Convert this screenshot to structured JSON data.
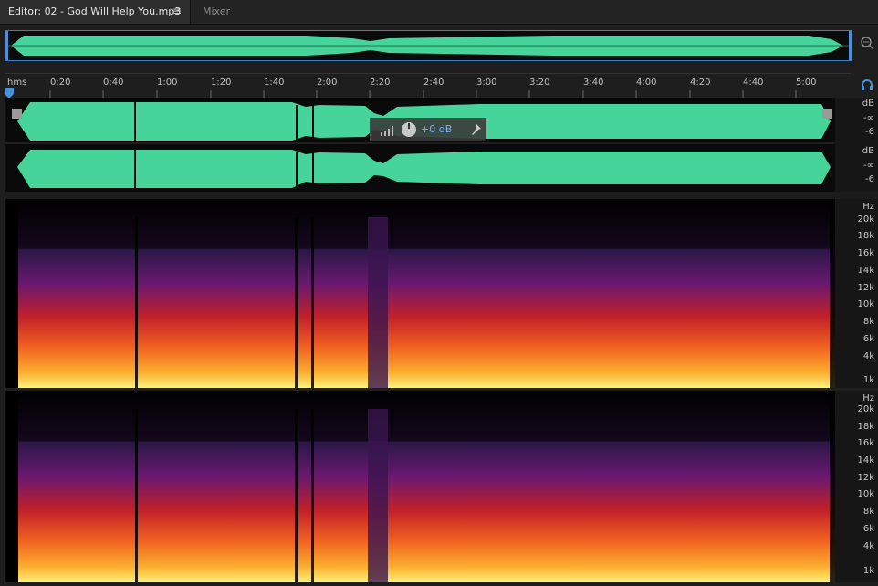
{
  "tabs": {
    "editor_title": "Editor: 02 - God Will Help You.mp3",
    "menu_glyph": "≡",
    "mixer_label": "Mixer"
  },
  "ruler": {
    "unit_label": "hms",
    "labels": [
      "0:20",
      "0:40",
      "1:00",
      "1:20",
      "1:40",
      "2:00",
      "2:20",
      "2:40",
      "3:00",
      "3:20",
      "3:40",
      "4:00",
      "4:20",
      "4:40",
      "5:00"
    ]
  },
  "waveform": {
    "channel1": {
      "unit": "dB",
      "values": [
        "-∞",
        "-6"
      ]
    },
    "channel2": {
      "unit": "dB",
      "values": [
        "-∞",
        "-6"
      ]
    },
    "color": "#46d49a"
  },
  "hud": {
    "gain": "+0 dB"
  },
  "spectral": {
    "unit": "Hz",
    "labels": [
      "20k",
      "18k",
      "16k",
      "14k",
      "12k",
      "10k",
      "8k",
      "6k",
      "4k",
      "1k"
    ]
  },
  "icons": [
    "zoom-icon",
    "headphones-icon",
    "volume-knob-icon",
    "pin-icon",
    "playhead-icon",
    "menu-icon"
  ]
}
